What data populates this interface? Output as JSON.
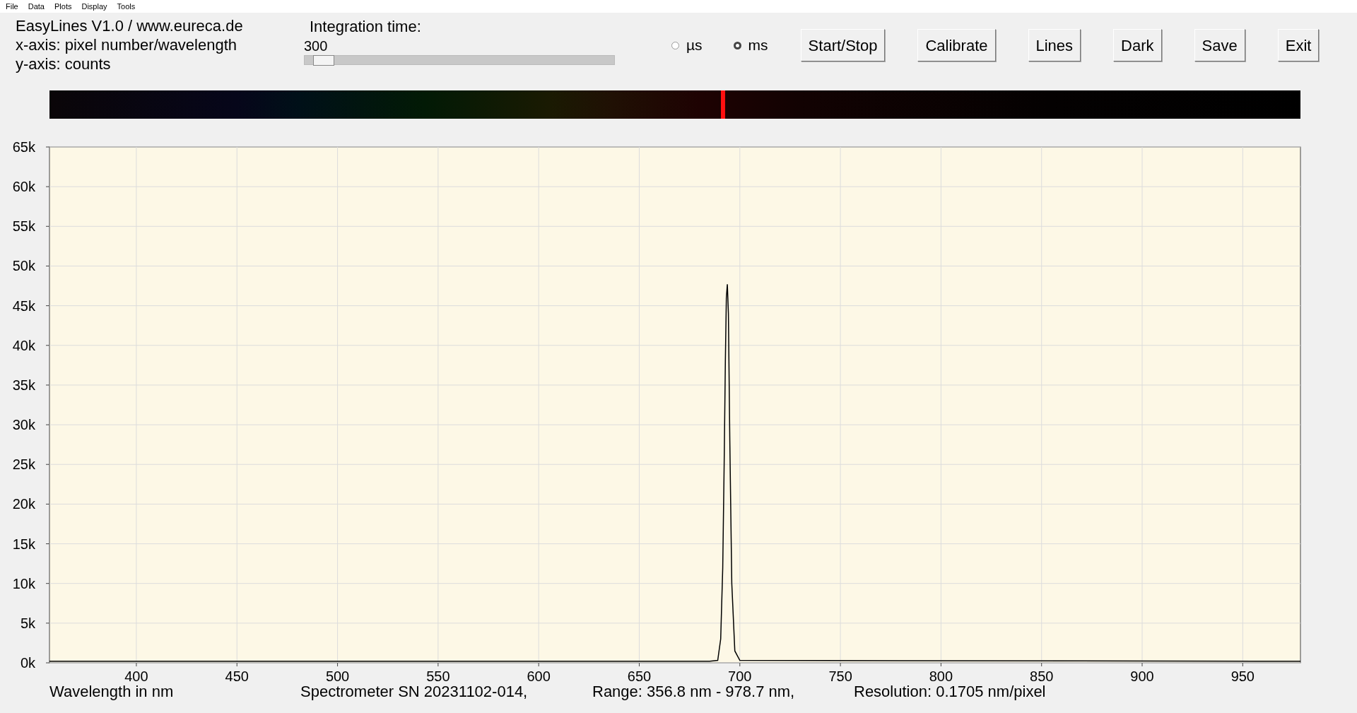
{
  "menu": [
    "File",
    "Data",
    "Plots",
    "Display",
    "Tools"
  ],
  "info_lines": [
    "EasyLines V1.0 / www.eureca.de",
    "x-axis: pixel number/wavelength",
    "y-axis: counts"
  ],
  "integration": {
    "label": "Integration time:",
    "value": "300",
    "level": 0.03
  },
  "units": [
    {
      "label": "µs",
      "selected": false
    },
    {
      "label": "ms",
      "selected": true
    }
  ],
  "buttons": [
    "Start/Stop",
    "Calibrate",
    "Lines",
    "Dark",
    "Save",
    "Exit"
  ],
  "chart_data": {
    "type": "line",
    "xlabel": "Wavelength in nm",
    "xlim": [
      356.8,
      978.7
    ],
    "ylim": [
      0,
      65000
    ],
    "xticks": [
      400,
      450,
      500,
      550,
      600,
      650,
      700,
      750,
      800,
      850,
      900,
      950
    ],
    "yticks": [
      {
        "value": 0,
        "label": "0k"
      },
      {
        "value": 5000,
        "label": "5k"
      },
      {
        "value": 10000,
        "label": "10k"
      },
      {
        "value": 15000,
        "label": "15k"
      },
      {
        "value": 20000,
        "label": "20k"
      },
      {
        "value": 25000,
        "label": "25k"
      },
      {
        "value": 30000,
        "label": "30k"
      },
      {
        "value": 35000,
        "label": "35k"
      },
      {
        "value": 40000,
        "label": "40k"
      },
      {
        "value": 45000,
        "label": "45k"
      },
      {
        "value": 50000,
        "label": "50k"
      },
      {
        "value": 55000,
        "label": "55k"
      },
      {
        "value": 60000,
        "label": "60k"
      },
      {
        "value": 65000,
        "label": "65k"
      }
    ],
    "x": [
      356.8,
      685,
      689,
      690.5,
      691.5,
      692.2,
      692.8,
      693.3,
      693.8,
      694.3,
      695,
      696,
      697.5,
      700,
      978.7
    ],
    "grid": true,
    "series": [
      {
        "color": "#000000",
        "values": [
          200,
          200,
          300,
          3000,
          12000,
          25000,
          38000,
          46000,
          47700,
          44000,
          28000,
          10000,
          1500,
          300,
          200
        ]
      }
    ]
  },
  "status": [
    "Spectrometer SN 20231102-014,",
    "Range: 356.8 nm - 978.7 nm,",
    "Resolution: 0.1705 nm/pixel"
  ]
}
